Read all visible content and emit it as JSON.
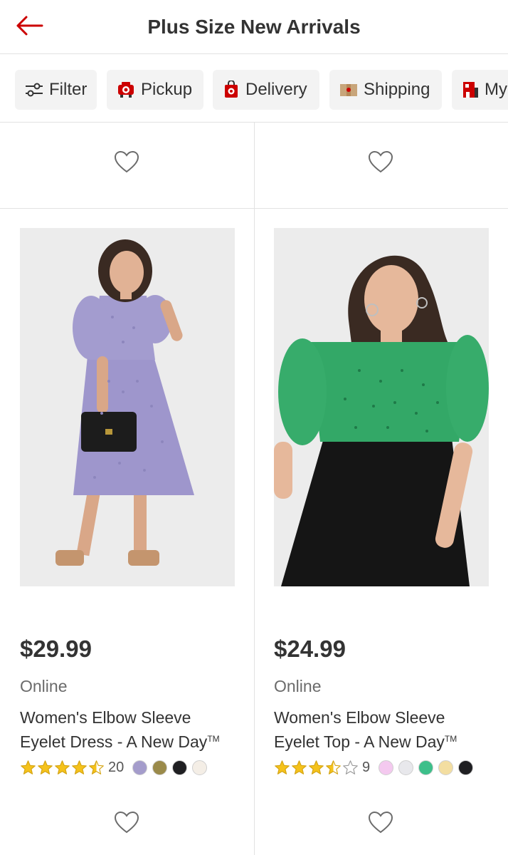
{
  "header": {
    "title": "Plus Size New Arrivals",
    "back_icon": "back-arrow-icon",
    "accent_color": "#cc0000"
  },
  "chips": [
    {
      "label": "Filter",
      "icon": "sliders-icon"
    },
    {
      "label": "Pickup",
      "icon": "pickup-icon"
    },
    {
      "label": "Delivery",
      "icon": "delivery-icon"
    },
    {
      "label": "Shipping",
      "icon": "shipping-box-icon"
    },
    {
      "label": "My",
      "icon": "store-icon"
    }
  ],
  "products": [
    {
      "price": "$29.99",
      "availability": "Online",
      "name_line1": "Women's Elbow Sleeve",
      "name_line2": "Eyelet Dress - A New Day",
      "trademark": "TM",
      "rating": 4.5,
      "review_count": "20",
      "image_desc": "Woman in lavender eyelet midi dress holding black bag",
      "swatches": [
        "#a49ccb",
        "#9a8a4a",
        "#1f1f22",
        "#f4eee6"
      ]
    },
    {
      "price": "$24.99",
      "availability": "Online",
      "name_line1": "Women's Elbow Sleeve",
      "name_line2": "Eyelet Top - A New Day",
      "trademark": "TM",
      "rating": 3.5,
      "review_count": "9",
      "image_desc": "Woman in green eyelet top with black pleated skirt",
      "swatches": [
        "#f4c9ef",
        "#e8e8ec",
        "#3dbf8a",
        "#f3dea1",
        "#1f1f22"
      ]
    }
  ]
}
